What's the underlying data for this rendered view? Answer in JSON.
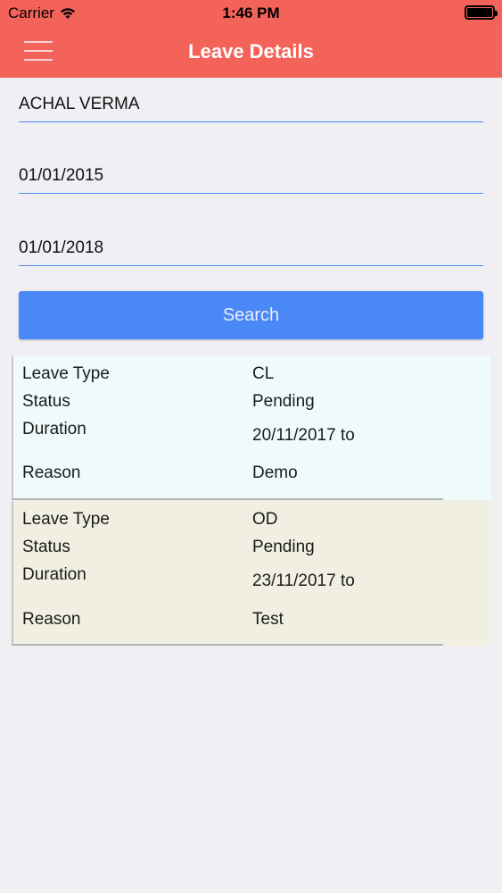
{
  "status_bar": {
    "carrier": "Carrier",
    "time": "1:46 PM"
  },
  "nav": {
    "title": "Leave Details"
  },
  "form": {
    "employee": "ACHAL VERMA",
    "from_date": "01/01/2015",
    "to_date": "01/01/2018",
    "search_label": "Search"
  },
  "labels": {
    "leave_type": "Leave Type",
    "status": "Status",
    "duration": "Duration",
    "reason": "Reason"
  },
  "leaves": [
    {
      "leave_type": "CL",
      "status": "Pending",
      "duration": "20/11/2017 to",
      "reason": "Demo",
      "color": "#effbfb"
    },
    {
      "leave_type": "OD",
      "status": "Pending",
      "duration": "23/11/2017 to",
      "reason": "Test",
      "color": "#f0efe2"
    }
  ],
  "colors": {
    "header": "#f4635a",
    "accent": "#4a88f6",
    "underline": "#4d8df5"
  }
}
